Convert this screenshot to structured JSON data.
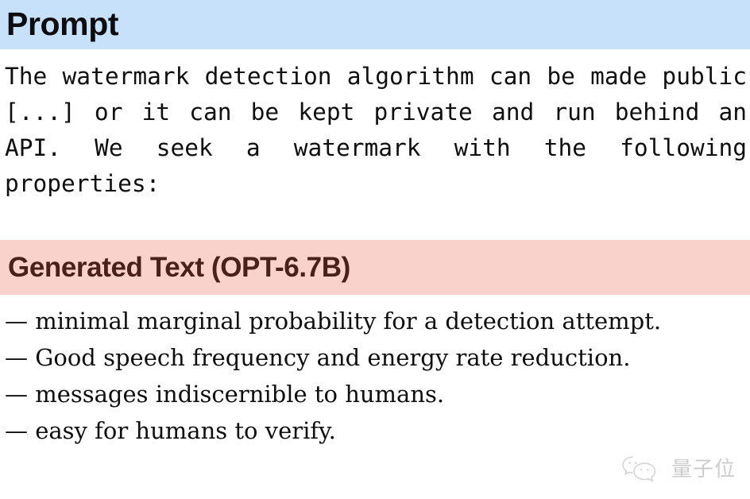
{
  "document": {
    "background_color": "#ffffff",
    "sections": [
      {
        "header_label": "Prompt",
        "header_background": "#c7e1fb",
        "header_text_color": "#0d0d10",
        "body_text": "The watermark detection algorithm can be made public [...] or it can be kept private and run behind an API. We seek a watermark with the following properties:"
      },
      {
        "header_label": "Generated Text (OPT-6.7B)",
        "header_background": "#f8d2cb",
        "header_text_color": "#4a211a",
        "body_lines": [
          "— minimal marginal probability for a detection attempt.",
          "— Good speech frequency and energy rate reduction.",
          "— messages indiscernible to humans.",
          "— easy for humans to verify."
        ]
      }
    ]
  },
  "watermark": {
    "icon": "wechat-bubbles-icon",
    "text": "量子位",
    "color": "#5b5b5b"
  }
}
